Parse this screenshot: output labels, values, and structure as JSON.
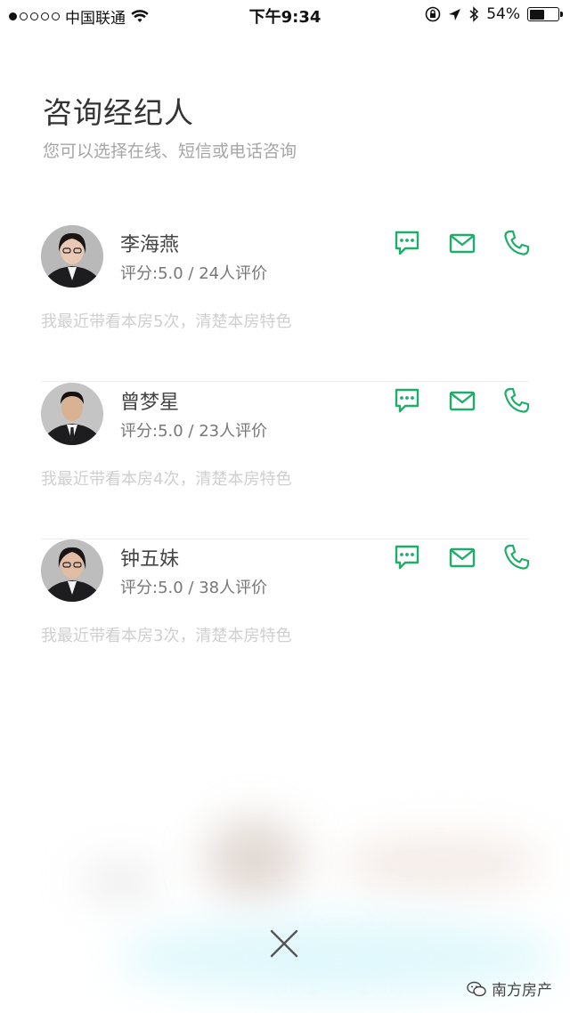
{
  "status_bar": {
    "signal_dots_filled": 1,
    "signal_dots_total": 5,
    "carrier": "中国联通",
    "time": "下午9:34",
    "battery_percent": "54%",
    "battery_level": 0.54
  },
  "header": {
    "title": "咨询经纪人",
    "subtitle": "您可以选择在线、短信或电话咨询"
  },
  "agents": [
    {
      "name": "李海燕",
      "rating": "评分:5.0 / 24人评价",
      "note": "我最近带看本房5次，清楚本房特色"
    },
    {
      "name": "曾梦星",
      "rating": "评分:5.0 / 23人评价",
      "note": "我最近带看本房4次，清楚本房特色"
    },
    {
      "name": "钟五妹",
      "rating": "评分:5.0 / 38人评价",
      "note": "我最近带看本房3次，清楚本房特色"
    }
  ],
  "icons": {
    "chat": "chat-bubble-icon",
    "sms": "envelope-icon",
    "phone": "phone-icon",
    "close": "close-icon"
  },
  "colors": {
    "accent": "#1fae6a",
    "title": "#333333",
    "subtitle": "#a6a6a6",
    "note": "#cfcfcf"
  },
  "watermark": "南方房产"
}
